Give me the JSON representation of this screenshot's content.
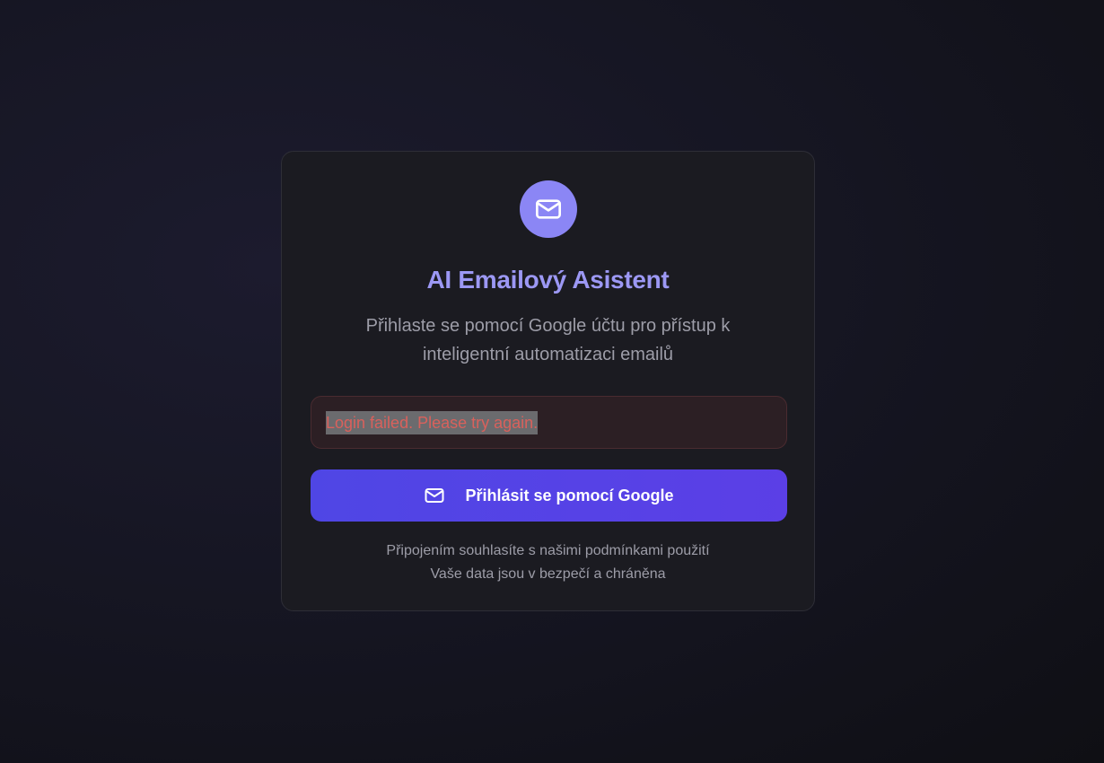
{
  "login": {
    "logo_icon": "mail-icon",
    "title": "AI Emailový Asistent",
    "subtitle": "Přihlaste se pomocí Google účtu pro přístup k inteligentní automatizaci emailů",
    "error_message": "Login failed. Please try again.",
    "button_label": "Přihlásit se pomocí Google",
    "button_icon": "mail-icon",
    "terms_text": "Připojením souhlasíte s našimi podmínkami použití",
    "security_text": "Vaše data jsou v bezpečí a chráněna"
  },
  "colors": {
    "accent": "#4f46e5",
    "logo_background": "#8b86f5",
    "title": "#9c98f4",
    "error_text": "#d9615c",
    "card_background": "#1b1b21"
  }
}
